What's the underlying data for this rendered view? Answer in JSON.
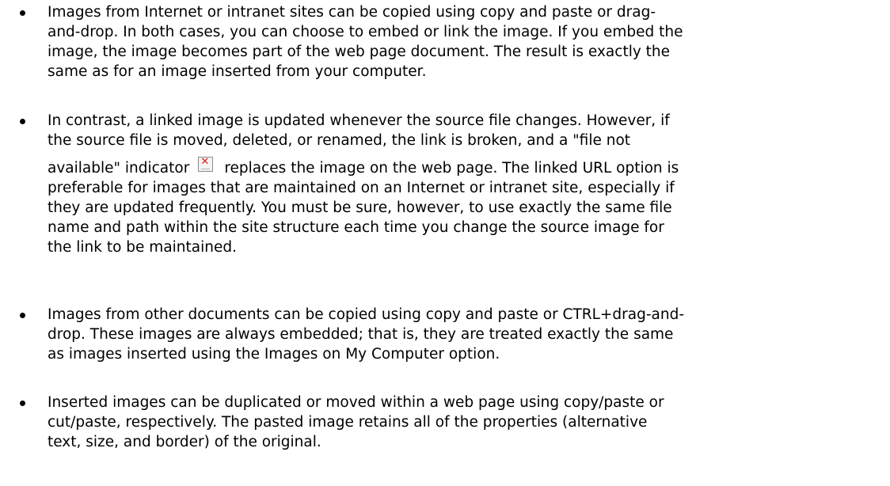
{
  "bullets": [
    {
      "lines": [
        "Images from Internet or intranet sites can be copied using copy and paste or drag-",
        "and-drop. In both cases, you can choose to embed or link the image. If you embed the",
        "image, the image becomes part of the web page document. The result is exactly the",
        "same as for an image inserted from your computer."
      ]
    },
    {
      "lines": [
        "In contrast, a linked image is updated whenever the source file changes. However, if",
        "the source file is moved, deleted, or renamed, the link is broken, and a \"file not"
      ],
      "icon_line": {
        "before": "available\" indicator",
        "icon": "broken-image-icon",
        "after": "replaces the image on the web page. The linked URL option is"
      },
      "lines_after": [
        "preferable for images that are maintained on an Internet or intranet site, especially if",
        "they are updated frequently. You must be sure, however, to use exactly the same file",
        "name and path within the site structure each time you change the source image for",
        "the link to be maintained."
      ]
    },
    {
      "lines": [
        "Images from other documents can be copied using copy and paste or CTRL+drag-and-",
        "drop. These images are always embedded; that is, they are treated exactly the same",
        "as images inserted using the Images on My Computer option."
      ]
    },
    {
      "lines": [
        "Inserted images can be duplicated or moved within a web page using copy/paste or",
        "cut/paste, respectively. The pasted image retains all of the properties (alternative",
        "text, size, and border) of the original."
      ]
    }
  ]
}
